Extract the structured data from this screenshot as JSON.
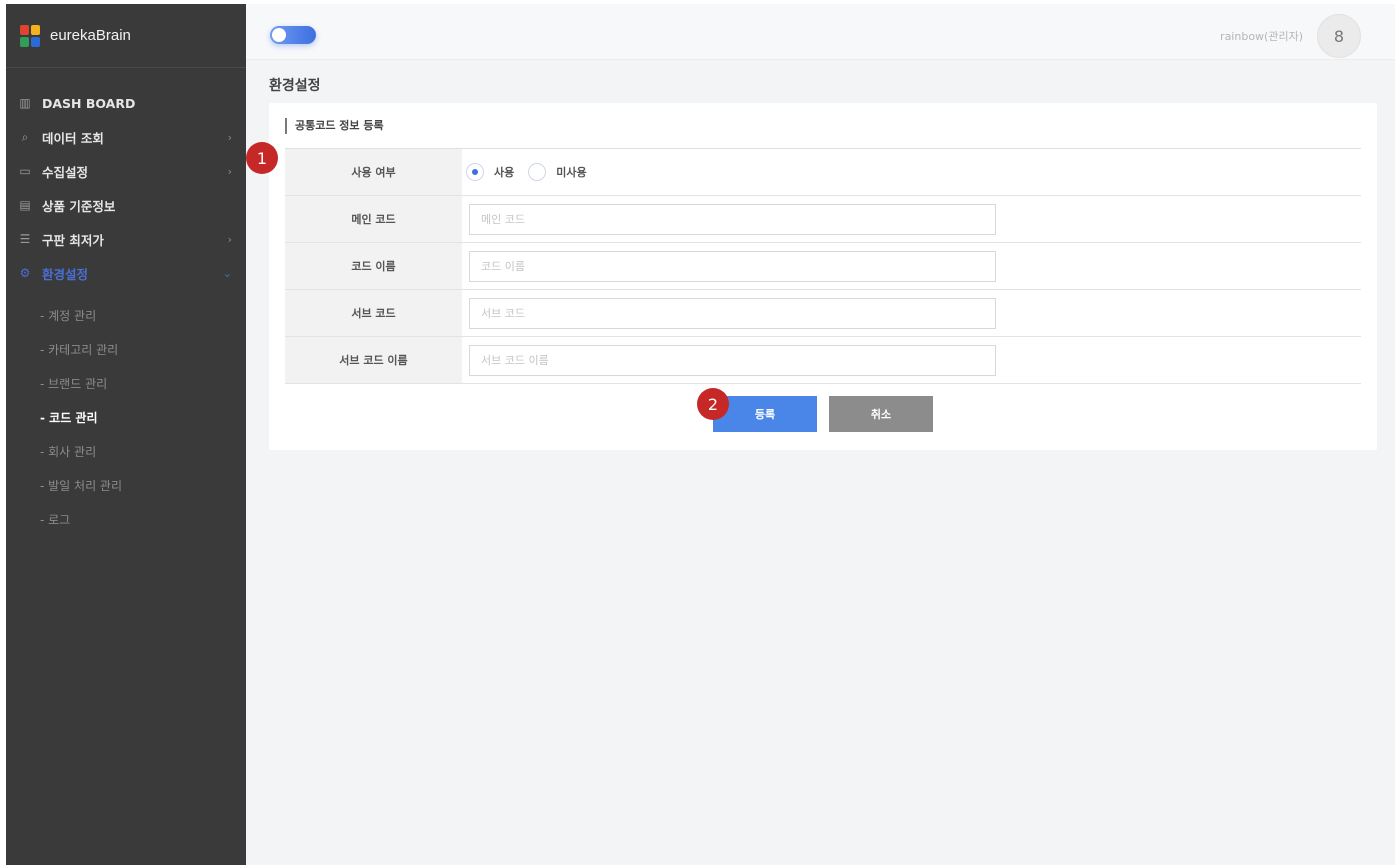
{
  "brand": {
    "name": "eurekaBrain",
    "logo_colors": [
      "#e0442e",
      "#f3b321",
      "#2f9e58",
      "#2c6bd6"
    ]
  },
  "sidebar": {
    "items": [
      {
        "label": "DASH BOARD",
        "icon": "dashboard-icon",
        "glyph": "▥",
        "arrow": ""
      },
      {
        "label": "데이터 조회",
        "icon": "search-icon",
        "glyph": "⌕",
        "arrow": "›"
      },
      {
        "label": "수집설정",
        "icon": "monitor-icon",
        "glyph": "▭",
        "arrow": "›"
      },
      {
        "label": "상품 기준정보",
        "icon": "list-icon",
        "glyph": "▤",
        "arrow": ""
      },
      {
        "label": "구판 최저가",
        "icon": "menu-icon",
        "glyph": "☰",
        "arrow": "›"
      },
      {
        "label": "환경설정",
        "icon": "gear-icon",
        "glyph": "⚙",
        "arrow": "⌄"
      }
    ],
    "subitems": [
      {
        "label": "- 계정 관리"
      },
      {
        "label": "- 카테고리 관리"
      },
      {
        "label": "- 브랜드 관리"
      },
      {
        "label": "- 코드 관리"
      },
      {
        "label": "- 회사 관리"
      },
      {
        "label": "- 발일 처리 관리"
      },
      {
        "label": "- 로그"
      }
    ],
    "active_item_index": 5,
    "active_subitem_index": 3
  },
  "topbar": {
    "user": "rainbow(관리자)",
    "avatar_initial": "8",
    "toggle_on": true
  },
  "page": {
    "title": "환경설정"
  },
  "form": {
    "section_title": "공통코드 정보 등록",
    "use_label": "사용 여부",
    "use_options": [
      "사용",
      "미사용"
    ],
    "use_selected": "사용",
    "fields": [
      {
        "label": "메인 코드",
        "placeholder": "메인 코드",
        "value": ""
      },
      {
        "label": "코드 이름",
        "placeholder": "코드 이름",
        "value": ""
      },
      {
        "label": "서브 코드",
        "placeholder": "서브 코드",
        "value": ""
      },
      {
        "label": "서브 코드 이름",
        "placeholder": "서브 코드 이름",
        "value": ""
      }
    ],
    "submit_label": "등록",
    "cancel_label": "취소"
  },
  "annotations": [
    {
      "number": "1"
    },
    {
      "number": "2"
    }
  ],
  "colors": {
    "sidebar_bg": "#3a3a3a",
    "active_menu": "#4a6fd4",
    "submit_button": "#4a86e8",
    "cancel_button": "#8c8c8c",
    "marker": "#c62828"
  }
}
